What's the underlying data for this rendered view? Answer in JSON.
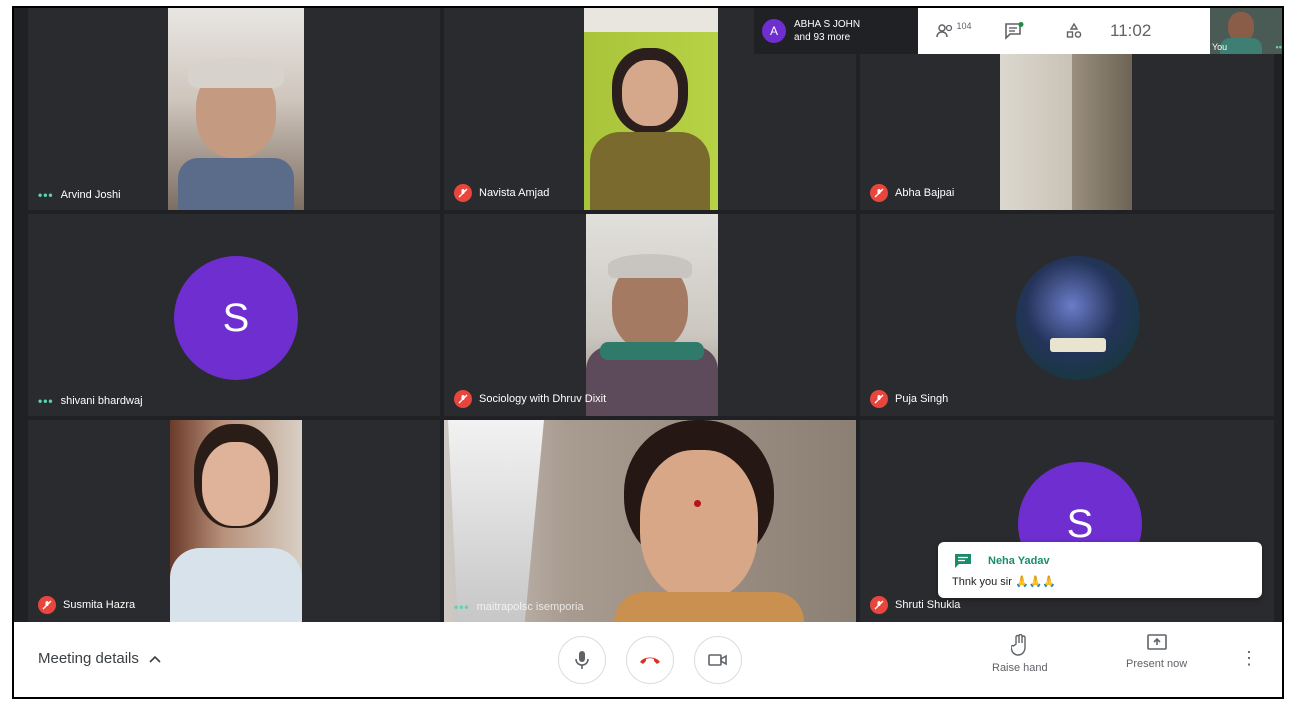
{
  "presenting": {
    "avatar_letter": "A",
    "line1": "ABHA S JOHN",
    "line2": "and 93 more"
  },
  "topbar": {
    "participant_count": "104",
    "time": "11:02",
    "self_label": "You"
  },
  "tiles": [
    {
      "name": "Arvind Joshi",
      "status": "active"
    },
    {
      "name": "Navista Amjad",
      "status": "muted"
    },
    {
      "name": "Abha Bajpai",
      "status": "muted"
    },
    {
      "name": "shivani bhardwaj",
      "status": "active",
      "avatar_letter": "S"
    },
    {
      "name": "Sociology with Dhruv Dixit",
      "status": "muted"
    },
    {
      "name": "Puja Singh",
      "status": "muted"
    },
    {
      "name": "Susmita Hazra",
      "status": "muted"
    },
    {
      "name": "maitrapolsc isemporia",
      "status": "active"
    },
    {
      "name": "Shruti Shukla",
      "status": "muted",
      "avatar_letter": "S"
    }
  ],
  "toast": {
    "name": "Neha Yadav",
    "message": "Thnk you sir 🙏🙏🙏"
  },
  "bottombar": {
    "meeting_details": "Meeting details",
    "raise_hand": "Raise hand",
    "present_now": "Present now"
  },
  "colors": {
    "accent": "#6f2ecf",
    "mute_red": "#e8453c",
    "active_green": "#5bd3b0",
    "end_call": "#d93025"
  }
}
